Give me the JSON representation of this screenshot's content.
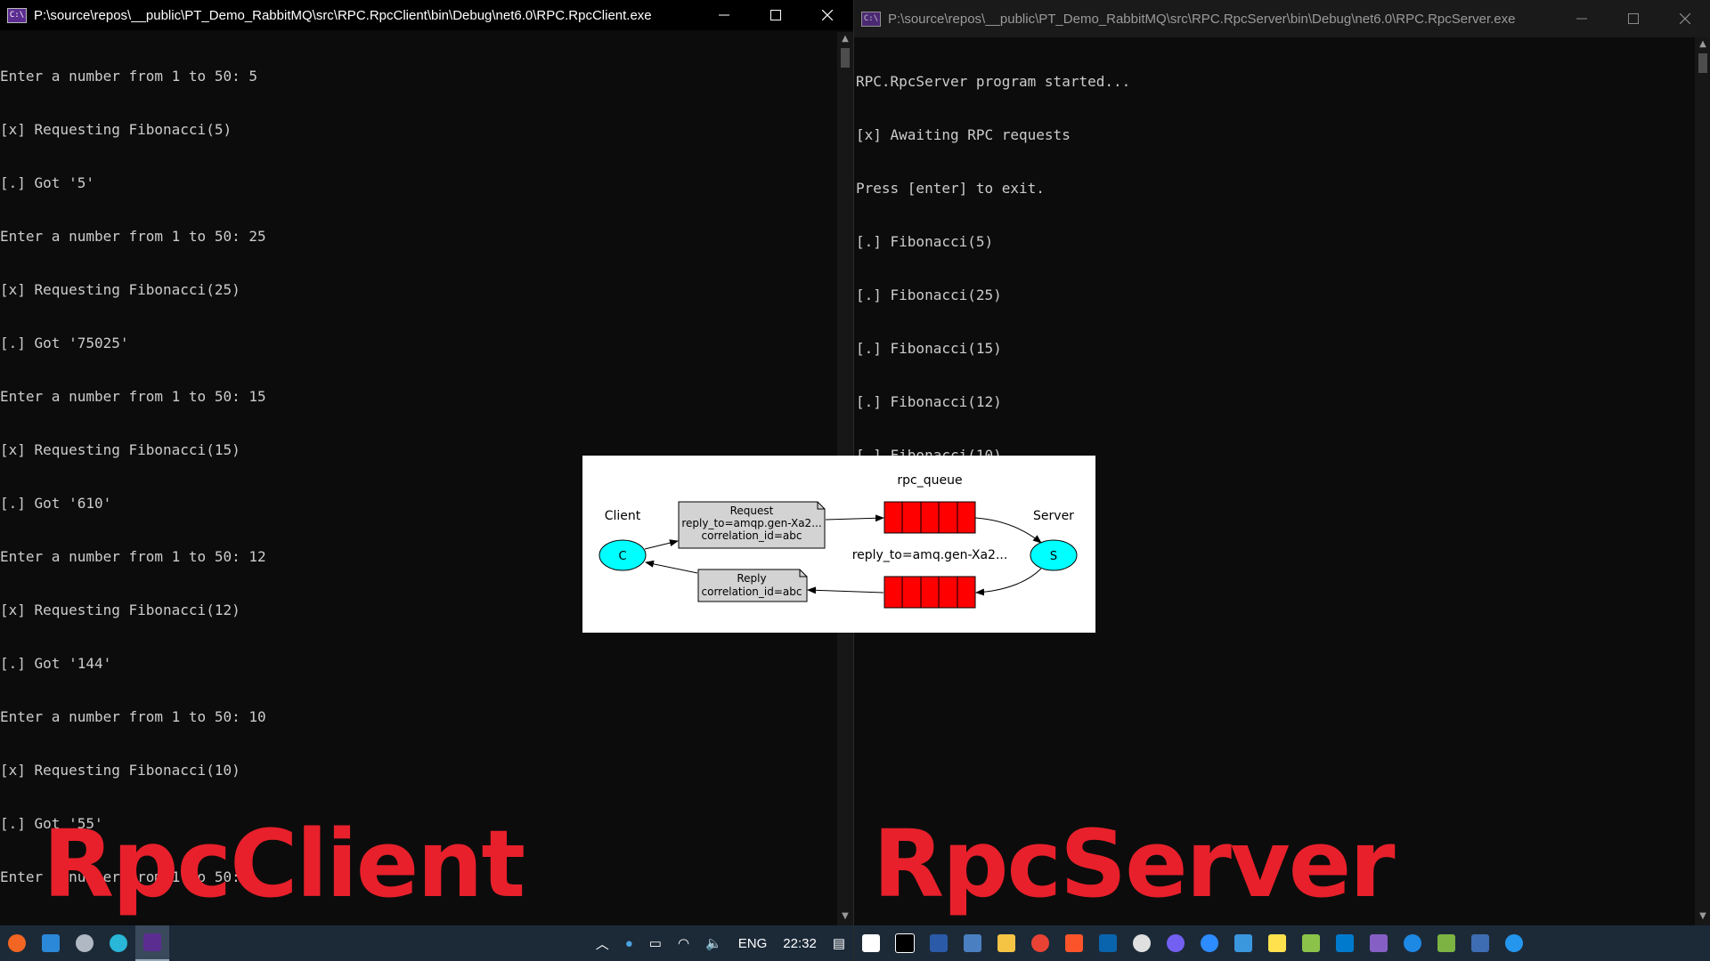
{
  "client_window": {
    "title": "P:\\source\\repos\\__public\\PT_Demo_RabbitMQ\\src\\RPC.RpcClient\\bin\\Debug\\net6.0\\RPC.RpcClient.exe",
    "lines": [
      "Enter a number from 1 to 50: 5",
      "[x] Requesting Fibonacci(5)",
      "[.] Got '5'",
      "Enter a number from 1 to 50: 25",
      "[x] Requesting Fibonacci(25)",
      "[.] Got '75025'",
      "Enter a number from 1 to 50: 15",
      "[x] Requesting Fibonacci(15)",
      "[.] Got '610'",
      "Enter a number from 1 to 50: 12",
      "[x] Requesting Fibonacci(12)",
      "[.] Got '144'",
      "Enter a number from 1 to 50: 10",
      "[x] Requesting Fibonacci(10)",
      "[.] Got '55'",
      "Enter a number from 1 to 50:"
    ],
    "overlay_label": "RpcClient"
  },
  "server_window": {
    "title": "P:\\source\\repos\\__public\\PT_Demo_RabbitMQ\\src\\RPC.RpcServer\\bin\\Debug\\net6.0\\RPC.RpcServer.exe",
    "lines": [
      "RPC.RpcServer program started...",
      "[x] Awaiting RPC requests",
      "Press [enter] to exit.",
      "[.] Fibonacci(5)",
      "[.] Fibonacci(25)",
      "[.] Fibonacci(15)",
      "[.] Fibonacci(12)",
      "[.] Fibonacci(10)"
    ],
    "overlay_label": "RpcServer"
  },
  "diagram": {
    "client_label": "Client",
    "client_node": "C",
    "server_label": "Server",
    "server_node": "S",
    "queue_label": "rpc_queue",
    "reply_queue_label": "reply_to=amq.gen-Xa2...",
    "request_note": [
      "Request",
      "reply_to=amqp.gen-Xa2...",
      "correlation_id=abc"
    ],
    "reply_note": [
      "Reply",
      "correlation_id=abc"
    ],
    "colors": {
      "node": "#00ffff",
      "queue": "#ff0000",
      "note": "#d3d3d3"
    }
  },
  "taskbar": {
    "left_icons": [
      "orange-app-icon",
      "photos-icon",
      "tool-icon",
      "cloud-icon",
      "console-icon"
    ],
    "tray": {
      "language": "ENG",
      "clock": "22:32"
    },
    "right_icons": [
      "windows-start-icon",
      "terminal-icon",
      "powershell-icon",
      "network-admin-icon",
      "file-explorer-icon",
      "chrome-icon",
      "brave-icon",
      "outlook-icon",
      "slack-icon",
      "viber-icon",
      "zoom-icon",
      "teams-icon",
      "sticky-notes-icon",
      "notepad-icon",
      "vscode-icon",
      "visual-studio-icon",
      "maps-icon",
      "paint-icon",
      "network-icon",
      "docker-icon"
    ]
  }
}
